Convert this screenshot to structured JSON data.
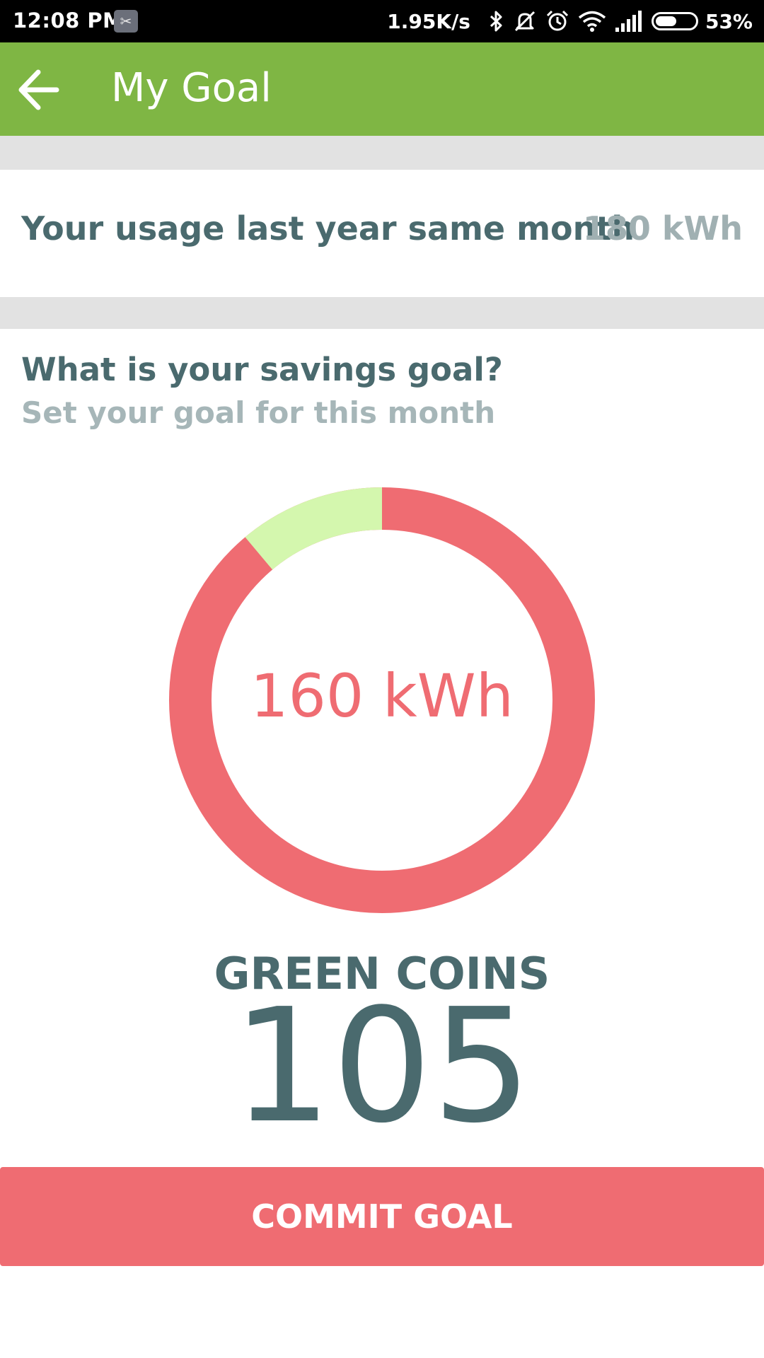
{
  "status_bar": {
    "time": "12:08 PM",
    "net_speed": "1.95K/s",
    "battery_text": "53%",
    "battery_level": 0.53,
    "icons": [
      "app-notification-icon",
      "bluetooth-icon",
      "mute-icon",
      "alarm-icon",
      "wifi-icon",
      "signal-icon",
      "battery-icon"
    ]
  },
  "app_bar": {
    "title": "My Goal",
    "background": "#7fb644",
    "back_icon": "arrow-left-icon"
  },
  "usage": {
    "label": "Your usage last year same month",
    "value": "180 kWh"
  },
  "goal": {
    "question": "What is your savings goal?",
    "subtitle": "Set your goal for this month",
    "value_label": "160 kWh",
    "goal_kwh": 160,
    "baseline_kwh": 180,
    "colors": {
      "usage": "#ef6c72",
      "savings": "#d4f7ae"
    }
  },
  "coins": {
    "title": "GREEN COINS",
    "value": "105"
  },
  "commit_button": {
    "label": "COMMIT GOAL",
    "color": "#ef6c72"
  }
}
